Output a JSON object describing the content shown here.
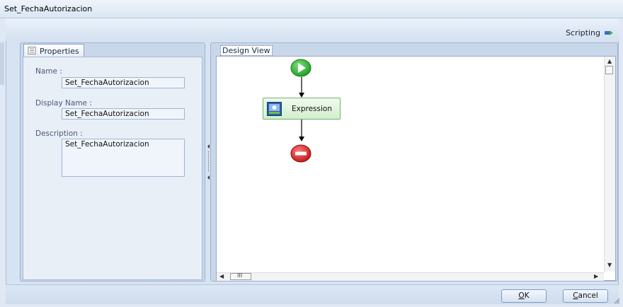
{
  "window": {
    "title": "Set_FechaAutorizacion"
  },
  "toolbar": {
    "scripting_label": "Scripting",
    "scripting_icon": "arrow-right-icon"
  },
  "properties": {
    "tab_label": "Properties",
    "tab_icon": "document-icon",
    "name_label": "Name :",
    "name_value": "Set_FechaAutorizacion",
    "display_name_label": "Display Name :",
    "display_name_value": "Set_FechaAutorizacion",
    "description_label": "Description :",
    "description_value": "Set_FechaAutorizacion"
  },
  "design": {
    "tab_label": "Design View",
    "start_icon": "play-circle-icon",
    "end_icon": "stop-circle-icon",
    "activity": {
      "label": "Expression",
      "icon": "expression-icon"
    },
    "hscroll_thumb_glyph": "III"
  },
  "footer": {
    "ok_label": "OK",
    "ok_accel": "O",
    "ok_rest": "K",
    "cancel_label": "Cancel",
    "cancel_accel": "C",
    "cancel_rest": "ancel"
  },
  "colors": {
    "start": "#2fb52f",
    "end": "#d42020",
    "activity_border": "#6fb36f",
    "frame": "#d7e3f2"
  }
}
